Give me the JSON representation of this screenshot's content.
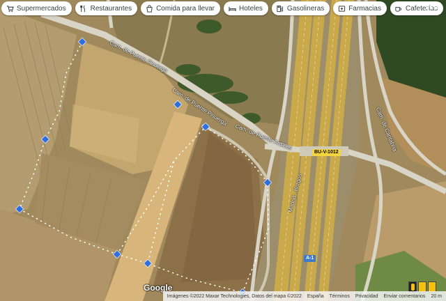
{
  "filters": [
    {
      "label": "Supermercados",
      "icon": "cart-icon"
    },
    {
      "label": "Restaurantes",
      "icon": "fork-knife-icon"
    },
    {
      "label": "Comida para llevar",
      "icon": "takeout-bag-icon"
    },
    {
      "label": "Hoteles",
      "icon": "bed-icon"
    },
    {
      "label": "Gasolineras",
      "icon": "fuel-pump-icon"
    },
    {
      "label": "Farmacias",
      "icon": "pharmacy-icon"
    },
    {
      "label": "Cafeterías",
      "icon": "coffee-cup-icon"
    }
  ],
  "roads": {
    "camino_upper": "Cam. de Puente Pisuerga",
    "camino_mid": "Cam. de Puente Pisuerga",
    "camino_lower": "Cam. de Puente Ardales",
    "right_road": "Cam. de Cantabria",
    "motorway": "Madrid - Burgos"
  },
  "shields": {
    "yellow": "BU-V-1012",
    "blue": "A-1"
  },
  "google_logo": "Google",
  "footer": {
    "imagery": "Imágenes ©2022 Maxar Technologies, Datos del mapa ©2022",
    "country": "España",
    "terms": "Términos",
    "privacy": "Privacidad",
    "feedback": "Enviar comentarios",
    "scale": "20 m"
  },
  "colors": {
    "field": "#a88f5d",
    "road": "#d4d0c4",
    "motorway": "#c9a94a",
    "measure_blue": "#2d6fe0"
  }
}
